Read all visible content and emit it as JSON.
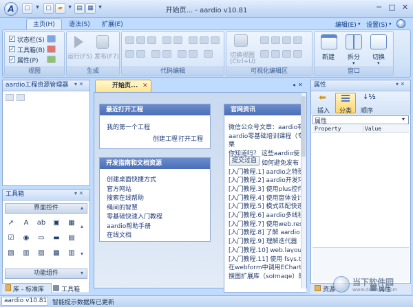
{
  "window": {
    "title": "开始页... - aardio v10.81",
    "logo_letter": "A",
    "controls": [
      "─",
      "□",
      "✕"
    ]
  },
  "quick_access": [
    "▾",
    "▢",
    "▾",
    "▤",
    "▾",
    "▾"
  ],
  "menus": {
    "tabs": [
      "主页(H)",
      "语法(S)",
      "扩展(E)"
    ],
    "right": [
      "编辑(E)",
      "设置(S)"
    ]
  },
  "ribbon": {
    "view_group": {
      "label": "视图",
      "checks": [
        {
          "label": "状态栏(S)",
          "checked": true
        },
        {
          "label": "工具箱(B)",
          "checked": true
        },
        {
          "label": "属性(P)",
          "checked": true
        }
      ]
    },
    "build_group": {
      "label": "生成",
      "buttons": [
        {
          "label": "运行(F5)",
          "disabled": true
        },
        {
          "label": "发布(F7)",
          "disabled": true
        }
      ]
    },
    "edit_group": {
      "label": "代码编辑"
    },
    "visual_group": {
      "label": "可视化编辑区",
      "switch_label": "切换视图",
      "switch_shortcut": "(Ctrl+U)"
    },
    "window_group": {
      "label": "窗口",
      "buttons": [
        {
          "label": "新建"
        },
        {
          "label": "拆分"
        },
        {
          "label": "切换"
        }
      ]
    }
  },
  "project_pane": {
    "title": "aardio工程资源管理器",
    "buttons": "▾ ✕"
  },
  "toolbox": {
    "title": "工具箱",
    "buttons": "▾ ✕",
    "section_controls": "界面控件",
    "section_functions": "功能组件",
    "bottom_tabs": [
      "库 - 标准库",
      "工具箱"
    ],
    "tool_glyphs": [
      "➚",
      "A",
      "ab",
      "▣",
      "▦",
      "☑",
      "◉",
      "▭",
      "▬",
      "▤",
      "▧",
      "▥",
      "▨",
      "▩",
      "▥"
    ]
  },
  "document": {
    "tab_label": "开始页...",
    "recent": {
      "title": "最近打开工程",
      "first_project": "我的第一个工程",
      "action_create": "创建工程",
      "action_open": "打开工程"
    },
    "guide": {
      "title": "开发指南和文档资源",
      "links": [
        "创建桌面快捷方式",
        "官方网站",
        "搜索在线帮助",
        "绳间的智慧",
        "零基础快速入门教程",
        "aardio帮助手册",
        "在线文档"
      ]
    },
    "news": {
      "title": "官网资讯",
      "lines": [
        "微信公众号文章：aardio有",
        "aardio零基础培训课程（专",
        "栗",
        "你知道吗？ 这些aardio使",
        "如何避免发布",
        "[入门教程.1] aardio之特殊",
        "[入门教程.2] aardio开发环",
        "[入门教程.3] 使用plus控件",
        "[入门教程.4] 使用窗体设计",
        "[入门教程.5] 模式匹配快速",
        "[入门教程.6] aardio多线程",
        "[入门教程.7] 使用web.res",
        "[入门教程.8] 了解 aardio",
        "[入门教程.9] 理解迭代器",
        "[入门教程.10] web.layout",
        "[入门教程.11] 使用 fsys.ta",
        "在webform中调用EChart",
        "搜图扩展库（soImage）的"
      ],
      "button": "提交过自"
    }
  },
  "properties": {
    "title": "属性",
    "buttons": "▾ ✕",
    "tools": [
      {
        "label": "插入",
        "icon": "arrow-left-icon"
      },
      {
        "label": "分类",
        "icon": "category-icon"
      },
      {
        "label": "顺序",
        "icon": "sort-icon"
      }
    ],
    "dropdown_value": "属性",
    "columns": [
      "Property",
      "Value"
    ],
    "bottom_tabs": [
      "资源",
      "属性"
    ]
  },
  "statusbar": {
    "version": "aardio v10.81",
    "message": "智能提示数据库已更新"
  },
  "watermark": {
    "text": "当下软件园",
    "url": "www.downxia.com"
  },
  "colors": {
    "accent": "#15428b",
    "tab_highlight": "#ffe38a",
    "card_header": "#4b6fb8"
  }
}
